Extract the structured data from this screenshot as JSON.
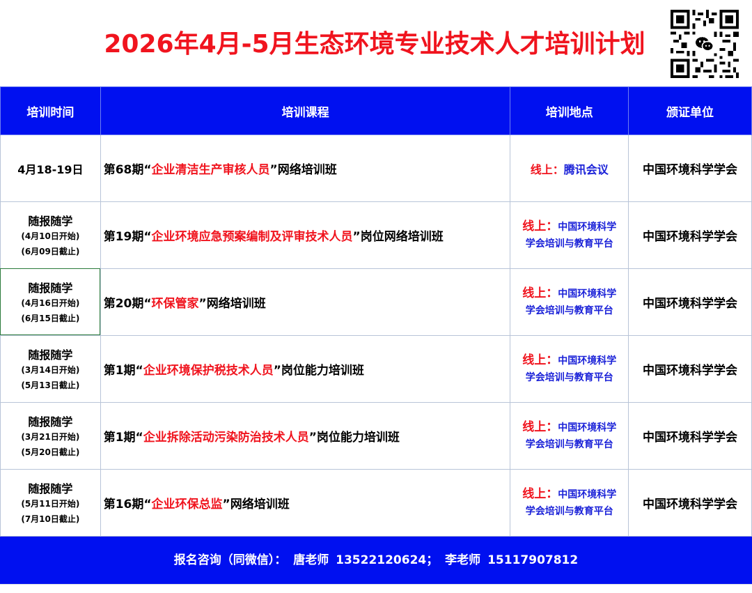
{
  "title": "2026年4月-5月生态环境专业技术人才培训计划",
  "qr_icon": "wechat-qr-code-icon",
  "headers": [
    "培训时间",
    "培训课程",
    "培训地点",
    "颁证单位"
  ],
  "rows": [
    {
      "date_main": "4月18-19日",
      "date_start": "",
      "date_end": "",
      "course_prefix": "第68期“",
      "course_highlight": "企业清洁生产审核人员",
      "course_suffix": "”网络培训班",
      "loc_label": "线上：",
      "loc_value": "腾讯会议",
      "cert": "中国环境科学学会"
    },
    {
      "date_main": "随报随学",
      "date_start": "(4月10日开始)",
      "date_end": "(6月09日截止)",
      "course_prefix": "第19期“",
      "course_highlight": "企业环境应急预案编制及评审技术人员",
      "course_suffix": "”岗位网络培训班",
      "loc_label": "线上：",
      "loc_value_line1": "中国环境科学",
      "loc_value_line2": "学会培训与教育平台",
      "cert": "中国环境科学学会"
    },
    {
      "date_main": "随报随学",
      "date_start": "(4月16日开始)",
      "date_end": "(6月15日截止)",
      "course_prefix": "第20期“",
      "course_highlight": "环保管家",
      "course_suffix": "”网络培训班",
      "loc_label": "线上：",
      "loc_value_line1": "中国环境科学",
      "loc_value_line2": "学会培训与教育平台",
      "cert": "中国环境科学学会"
    },
    {
      "date_main": "随报随学",
      "date_start": "(3月14日开始)",
      "date_end": "(5月13日截止)",
      "course_prefix": "第1期“",
      "course_highlight": "企业环境保护税技术人员",
      "course_suffix": "”岗位能力培训班",
      "loc_label": "线上：",
      "loc_value_line1": "中国环境科学",
      "loc_value_line2": "学会培训与教育平台",
      "cert": "中国环境科学学会"
    },
    {
      "date_main": "随报随学",
      "date_start": "(3月21日开始)",
      "date_end": "(5月20日截止)",
      "course_prefix": "第1期“",
      "course_highlight": "企业拆除活动污染防治技术人员",
      "course_suffix": "”岗位能力培训班",
      "loc_label": "线上：",
      "loc_value_line1": "中国环境科学",
      "loc_value_line2": "学会培训与教育平台",
      "cert": "中国环境科学学会"
    },
    {
      "date_main": "随报随学",
      "date_start": "(5月11日开始)",
      "date_end": "(7月10日截止)",
      "course_prefix": "第16期“",
      "course_highlight": "企业环保总监",
      "course_suffix": "”网络培训班",
      "loc_label": "线上：",
      "loc_value_line1": "中国环境科学",
      "loc_value_line2": "学会培训与教育平台",
      "cert": "中国环境科学学会"
    }
  ],
  "footer": {
    "label": "报名咨询（同微信）：",
    "contact1_name": "唐老师",
    "contact1_phone": "13522120624；",
    "contact2_name": "李老师",
    "contact2_phone": "15117907812"
  },
  "colors": {
    "title_red": "#f0141e",
    "header_blue": "#0010f0",
    "location_blue": "#1b22d8"
  }
}
